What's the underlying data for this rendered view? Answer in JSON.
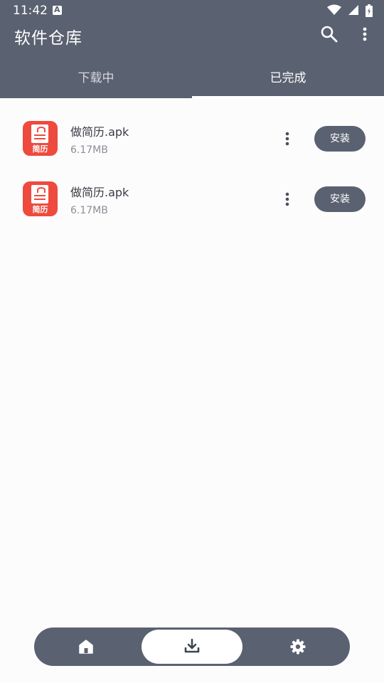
{
  "status_bar": {
    "time": "11:42"
  },
  "app_bar": {
    "title": "软件仓库"
  },
  "tabs": [
    {
      "label": "下载中",
      "selected": false
    },
    {
      "label": "已完成",
      "selected": true
    }
  ],
  "files": [
    {
      "name": "做简历.apk",
      "size": "6.17MB",
      "icon_label": "简历",
      "action_label": "安装"
    },
    {
      "name": "做简历.apk",
      "size": "6.17MB",
      "icon_label": "简历",
      "action_label": "安装"
    }
  ],
  "bottom_nav": [
    {
      "icon": "home-icon",
      "selected": false
    },
    {
      "icon": "download-icon",
      "selected": true
    },
    {
      "icon": "settings-icon",
      "selected": false
    }
  ],
  "colors": {
    "primary": "#5a6170",
    "icon_red": "#ef4a3e",
    "background": "#fcfcfc"
  }
}
